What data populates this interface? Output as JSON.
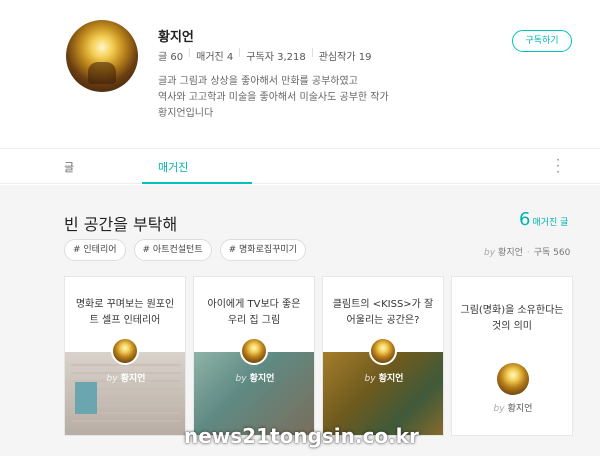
{
  "profile": {
    "name": "황지언",
    "stats": {
      "posts_label": "글",
      "posts": "60",
      "magazines_label": "매거진",
      "magazines": "4",
      "subscribers_label": "구독자",
      "subscribers": "3,218",
      "following_label": "관심작가",
      "following": "19"
    },
    "bio": [
      "글과 그림과 상상을 좋아해서 만화를 공부하였고",
      "역사와 고고학과 미술을 좋아해서 미술사도 공부한 작가",
      "황지언입니다"
    ],
    "subscribe_label": "구독하기",
    "accent": "#00c3bd"
  },
  "tabs": [
    {
      "label": "글",
      "active": false
    },
    {
      "label": "매거진",
      "active": true
    }
  ],
  "more_icon": "more-vertical-icon",
  "magazine": {
    "title": "빈 공간을 부탁해",
    "count": "6",
    "count_label": "매거진 글",
    "tags": [
      "# 인테리어",
      "# 아트컨설턴트",
      "# 명화로집꾸미기"
    ],
    "byline_by": "by",
    "byline_author": "황지언",
    "byline_subs": "구독 560",
    "cards": [
      {
        "title": "명화로 꾸며보는 원포인트 셀프 인테리어",
        "by": "by",
        "author": "황지언"
      },
      {
        "title": "아이에게 TV보다 좋은 우리 집 그림",
        "by": "by",
        "author": "황지언"
      },
      {
        "title": "클림트의 <KISS>가 잘 어울리는 공간은?",
        "by": "by",
        "author": "황지언"
      },
      {
        "title": "그림(명화)을 소유한다는 것의 의미",
        "by": "by",
        "author": "황지언"
      }
    ]
  },
  "watermark": "news21tongsin.co.kr"
}
